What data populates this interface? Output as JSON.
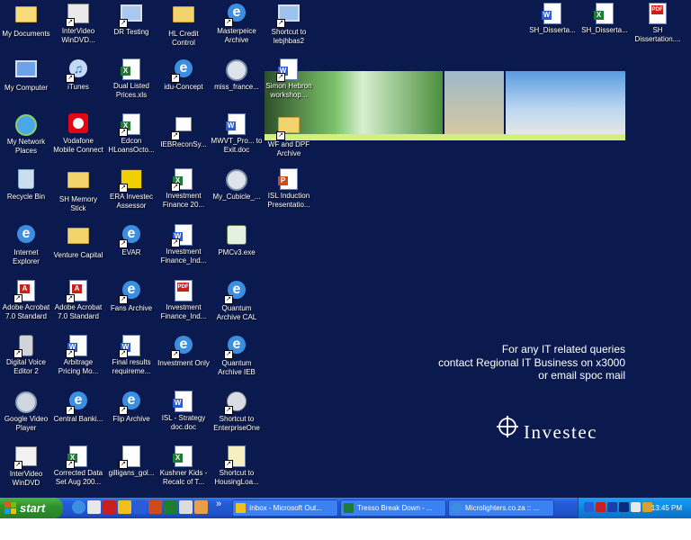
{
  "desktop": {
    "background_color": "#0b1a4e",
    "icons_col1": [
      {
        "label": "My Documents",
        "icon": "my-documents-icon"
      },
      {
        "label": "My Computer",
        "icon": "my-computer-icon"
      },
      {
        "label": "My Network Places",
        "icon": "network-places-icon"
      },
      {
        "label": "Recycle Bin",
        "icon": "recycle-bin-icon"
      },
      {
        "label": "Internet Explorer",
        "icon": "internet-explorer-icon"
      },
      {
        "label": "Adobe Acrobat 7.0 Standard",
        "icon": "acrobat-icon"
      },
      {
        "label": "Digital Voice Editor 2",
        "icon": "voice-editor-icon"
      },
      {
        "label": "Google Video Player",
        "icon": "video-player-icon"
      },
      {
        "label": "InterVideo WinDVD",
        "icon": "windvd-icon"
      }
    ],
    "icons_col2": [
      {
        "label": "InterVideo WinDVD...",
        "icon": "windvd-icon"
      },
      {
        "label": "iTunes",
        "icon": "itunes-icon"
      },
      {
        "label": "Vodafone Mobile Connect",
        "icon": "vodafone-icon"
      },
      {
        "label": "SH Memory Stick",
        "icon": "folder-icon"
      },
      {
        "label": "Venture Capital",
        "icon": "folder-icon"
      },
      {
        "label": "Adobe Acrobat 7.0 Standard",
        "icon": "acrobat-icon"
      },
      {
        "label": "Arbitrage Pricing Mo...",
        "icon": "word-doc-icon"
      },
      {
        "label": "Central Banki...",
        "icon": "ie-shortcut-icon"
      },
      {
        "label": "Corrected Data Set Aug 200...",
        "icon": "excel-doc-icon"
      }
    ],
    "icons_col3": [
      {
        "label": "DR Testing",
        "icon": "dr-testing-icon"
      },
      {
        "label": "Dual Listed Prices.xls",
        "icon": "excel-doc-icon"
      },
      {
        "label": "Edcon HLoansOcto...",
        "icon": "excel-doc-icon"
      },
      {
        "label": "ERA Investec Assessor",
        "icon": "era-assessor-icon"
      },
      {
        "label": "EVAR",
        "icon": "ie-shortcut-icon"
      },
      {
        "label": "Fans Archive",
        "icon": "ie-shortcut-icon"
      },
      {
        "label": "Final results requireme...",
        "icon": "word-doc-icon"
      },
      {
        "label": "Flip Archive",
        "icon": "ie-shortcut-icon"
      },
      {
        "label": "gilligans_gol...",
        "icon": "text-doc-icon"
      }
    ],
    "icons_col4": [
      {
        "label": "HL Credit Control",
        "icon": "folder-icon"
      },
      {
        "label": "idu-Concept",
        "icon": "ie-shortcut-icon"
      },
      {
        "label": "IEBReconSy...",
        "icon": "app-shortcut-icon"
      },
      {
        "label": "Investment Finance 20...",
        "icon": "excel-doc-icon"
      },
      {
        "label": "Investment Finance_Ind...",
        "icon": "word-doc-icon"
      },
      {
        "label": "Investment Finance_Ind...",
        "icon": "pdf-doc-icon"
      },
      {
        "label": "Investment Only",
        "icon": "ie-shortcut-icon"
      },
      {
        "label": "ISL - Strategy doc.doc",
        "icon": "word-doc-icon"
      },
      {
        "label": "Kushner Kids - Recalc of T...",
        "icon": "excel-doc-icon"
      }
    ],
    "icons_col5": [
      {
        "label": "Masterpeice Archive",
        "icon": "ie-shortcut-icon"
      },
      {
        "label": "miss_france...",
        "icon": "media-player-icon"
      },
      {
        "label": "MWVT_Pro... to Exit.doc",
        "icon": "word-doc-icon"
      },
      {
        "label": "My_Cubicle_...",
        "icon": "media-player-icon"
      },
      {
        "label": "PMCv3.exe",
        "icon": "pmc-exe-icon"
      },
      {
        "label": "Quantum Archive CAL",
        "icon": "ie-shortcut-icon"
      },
      {
        "label": "Quantum Archive IEB",
        "icon": "ie-shortcut-icon"
      },
      {
        "label": "Shortcut to EnterpriseOne",
        "icon": "globe-shortcut-icon"
      },
      {
        "label": "Shortcut to HousingLoa...",
        "icon": "housing-loan-icon"
      }
    ],
    "icons_col6": [
      {
        "label": "Shortcut to lebjhbas2",
        "icon": "server-shortcut-icon"
      },
      {
        "label": "Simon Hebron workshop...",
        "icon": "word-doc-icon"
      },
      {
        "label": "WF and DPF Archive",
        "icon": "folder-icon"
      },
      {
        "label": "ISL Induction Presentatio...",
        "icon": "ppt-doc-icon"
      }
    ],
    "icons_top_right": [
      {
        "label": "SH_Disserta...",
        "icon": "word-doc-icon"
      },
      {
        "label": "SH_Disserta...",
        "icon": "excel-doc-icon"
      },
      {
        "label": "SH Dissertation....",
        "icon": "pdf-doc-icon"
      }
    ],
    "it_message": {
      "line1": "For any IT related queries",
      "line2": "contact Regional IT Business on x3000",
      "line3": "or email spoc mail"
    },
    "logo_text": "Investec"
  },
  "taskbar": {
    "start_label": "start",
    "quick_launch_more": "»",
    "tasks": [
      {
        "label": "Inbox - Microsoft Out...",
        "icon": "outlook-icon"
      },
      {
        "label": "Tresso Break Down - ...",
        "icon": "excel-icon"
      },
      {
        "label": "Microlighters.co.za :: ...",
        "icon": "ie-icon"
      }
    ],
    "clock": "13:45 PM"
  }
}
